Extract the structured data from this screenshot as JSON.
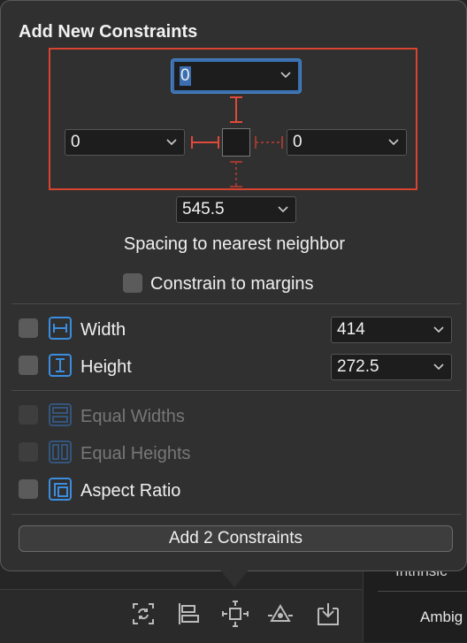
{
  "popover": {
    "title": "Add New Constraints",
    "spacing": {
      "top_value": "0",
      "left_value": "0",
      "right_value": "0",
      "bottom_value": "545.5",
      "spacing_label": "Spacing to nearest neighbor",
      "constrain_margins_label": "Constrain to margins"
    },
    "size": {
      "width_label": "Width",
      "width_value": "414",
      "height_label": "Height",
      "height_value": "272.5"
    },
    "equal": {
      "equal_widths_label": "Equal Widths",
      "equal_heights_label": "Equal Heights",
      "aspect_ratio_label": "Aspect Ratio"
    },
    "add_button_label": "Add 2 Constraints"
  },
  "background": {
    "partial_text_1": "Intrinsic",
    "partial_text_2": "Ambig"
  },
  "toolbar": {
    "icons": [
      "update-frames-icon",
      "align-icon",
      "add-constraints-icon",
      "resolve-issues-icon",
      "embed-in-icon"
    ]
  },
  "colors": {
    "accent_red": "#d9432f",
    "accent_blue": "#3a6fb0",
    "panel": "#303030"
  }
}
